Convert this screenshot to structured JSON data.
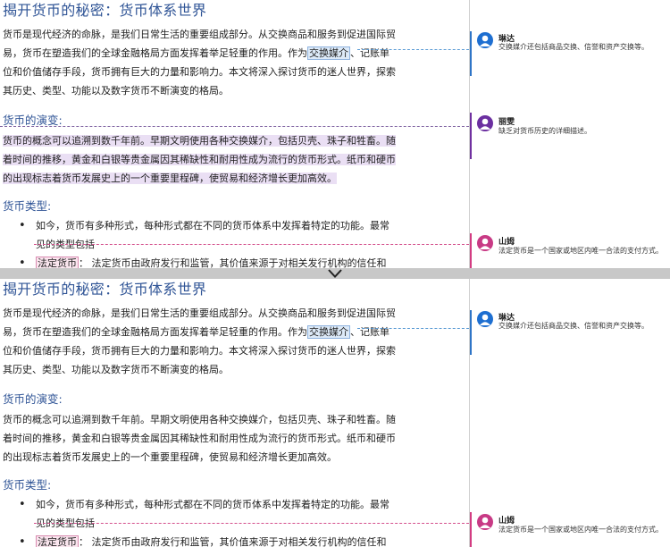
{
  "document": {
    "title": "揭开货币的秘密：货币体系世界",
    "intro_p1": "货币是现代经济的命脉，是我们日常生活的重要组成部分。从交换商品和服务到促进国际贸易，货币在塑造我们的全球金融格局方面发挥着举足轻重的作用。作为",
    "intro_highlight": "交换媒介",
    "intro_p2": "、记账单位和价值储存手段，货币拥有巨大的力量和影响力。本文将深入探讨货币的迷人世界，探索其历史、类型、功能以及数字货币不断演变的格局。",
    "h2_evolution": "货币的演变:",
    "evolution_text": "货币的概念可以追溯到数千年前。早期文明使用各种交换媒介，包括贝壳、珠子和牲畜。随着时间的推移，黄金和白银等贵金属因其稀缺性和耐用性成为流行的货币形式。纸币和硬币的出现标志着货币发展史上的一个重要里程碑，使贸易和经济增长更加高效。",
    "h2_types": "货币类型:",
    "bullet1": "如今，货币有多种形式，每种形式都在不同的货币体系中发挥着特定的功能。最常见的类型包括",
    "bullet2_highlight": "法定货币",
    "bullet2_rest": "： 法定货币由政府发行和监管，其价值来源于对相关发行机构的信任和"
  },
  "comments": [
    {
      "author": "琳达",
      "text": "交换媒介还包括商品交换、信誉和资产交换等。",
      "color": "#2f75c7",
      "icon": "user-avatar-icon"
    },
    {
      "author": "丽雯",
      "text": "缺乏对货币历史的详细描述。",
      "color": "#7030a0",
      "icon": "user-avatar-icon"
    },
    {
      "author": "山姆",
      "text": "法定货币是一个国家或地区内唯一合法的支付方式。",
      "color": "#d33c82",
      "icon": "user-avatar-icon"
    }
  ],
  "splitter": {
    "icon": "chevron-down-icon"
  }
}
